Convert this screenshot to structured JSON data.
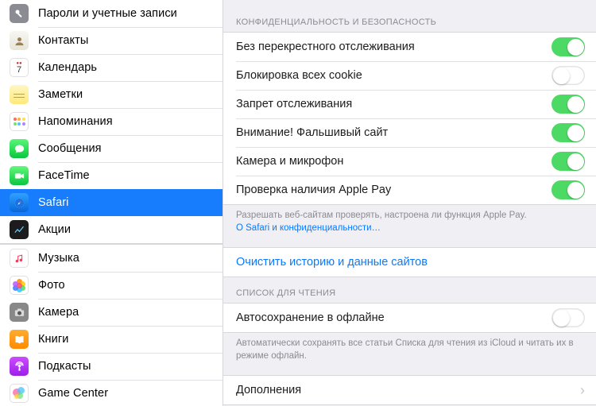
{
  "sidebar": {
    "group1": [
      {
        "label": "Пароли и учетные записи",
        "icon": "key-icon"
      },
      {
        "label": "Контакты",
        "icon": "contacts-icon"
      },
      {
        "label": "Календарь",
        "icon": "calendar-icon"
      },
      {
        "label": "Заметки",
        "icon": "notes-icon"
      },
      {
        "label": "Напоминания",
        "icon": "reminders-icon"
      },
      {
        "label": "Сообщения",
        "icon": "messages-icon"
      },
      {
        "label": "FaceTime",
        "icon": "facetime-icon"
      },
      {
        "label": "Safari",
        "icon": "safari-icon"
      },
      {
        "label": "Акции",
        "icon": "stocks-icon"
      }
    ],
    "group2": [
      {
        "label": "Музыка",
        "icon": "music-icon"
      },
      {
        "label": "Фото",
        "icon": "photos-icon"
      },
      {
        "label": "Камера",
        "icon": "camera-icon"
      },
      {
        "label": "Книги",
        "icon": "books-icon"
      },
      {
        "label": "Подкасты",
        "icon": "podcasts-icon"
      },
      {
        "label": "Game Center",
        "icon": "gamecenter-icon"
      }
    ],
    "selected": "Safari"
  },
  "privacy": {
    "header": "Конфиденциальность и безопасность",
    "rows": [
      {
        "label": "Без перекрестного отслеживания",
        "on": true
      },
      {
        "label": "Блокировка всех cookie",
        "on": false
      },
      {
        "label": "Запрет отслеживания",
        "on": true
      },
      {
        "label": "Внимание! Фальшивый сайт",
        "on": true
      },
      {
        "label": "Камера и микрофон",
        "on": true
      },
      {
        "label": "Проверка наличия Apple Pay",
        "on": true
      }
    ],
    "note_text": "Разрешать веб-сайтам проверять, настроена ли функция Apple Pay.",
    "note_link": "О Safari и конфиденциальности…"
  },
  "clear": {
    "label": "Очистить историю и данные сайтов"
  },
  "reading": {
    "header": "Список для чтения",
    "row_label": "Автосохранение в офлайне",
    "row_on": false,
    "note": "Автоматически сохранять все статьи Списка для чтения из iCloud и читать их в режиме офлайн."
  },
  "addons": {
    "label": "Дополнения"
  }
}
